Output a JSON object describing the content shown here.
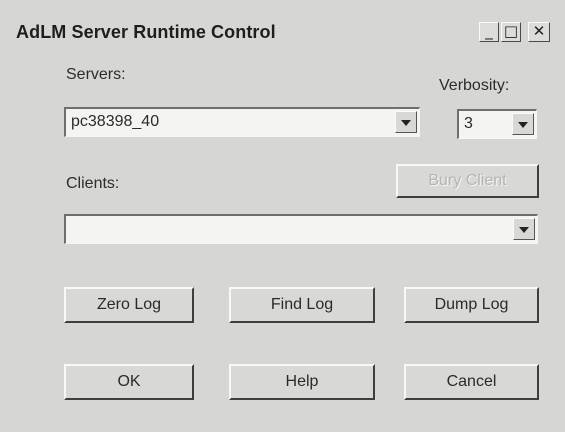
{
  "window": {
    "title": "AdLM Server Runtime Control",
    "controls": {
      "minimize": "_",
      "maximize": "□",
      "close": "✕"
    }
  },
  "servers": {
    "label": "Servers:",
    "value": "pc38398_40"
  },
  "verbosity": {
    "label": "Verbosity:",
    "value": "3"
  },
  "clients": {
    "label": "Clients:",
    "value": ""
  },
  "buttons": {
    "bury_client": "Bury Client",
    "zero_log": "Zero Log",
    "find_log": "Find Log",
    "dump_log": "Dump Log",
    "ok": "OK",
    "help": "Help",
    "cancel": "Cancel"
  },
  "icons": {
    "minimize": "minimize-icon",
    "maximize": "maximize-icon",
    "close": "close-icon",
    "dropdown": "chevron-down-icon"
  }
}
